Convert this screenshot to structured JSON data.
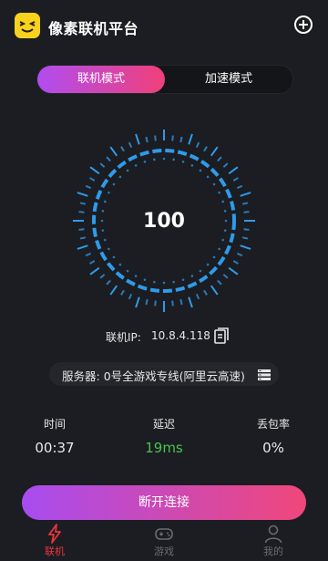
{
  "header": {
    "title": "像素联机平台",
    "logo_icon": "pixel-face-logo",
    "add_icon": "plus-circle-icon"
  },
  "mode": {
    "tabs": [
      {
        "label": "联机模式",
        "active": true
      },
      {
        "label": "加速模式",
        "active": false
      }
    ]
  },
  "dial": {
    "value": "100",
    "color": "#2f9bea"
  },
  "connection": {
    "ip_label": "联机IP:",
    "ip_value": "10.8.4.118"
  },
  "server": {
    "label": "服务器:",
    "value": "0号全游戏专线(阿里云高速)"
  },
  "stats": [
    {
      "label": "时间",
      "value": "00:37"
    },
    {
      "label": "延迟",
      "value": "19ms",
      "color": "#49c44e"
    },
    {
      "label": "丢包率",
      "value": "0%"
    }
  ],
  "disconnect_label": "断开连接",
  "nav": [
    {
      "label": "联机",
      "icon": "lightning-icon",
      "active": true
    },
    {
      "label": "游戏",
      "icon": "gamepad-icon",
      "active": false
    },
    {
      "label": "我的",
      "icon": "person-icon",
      "active": false
    }
  ]
}
